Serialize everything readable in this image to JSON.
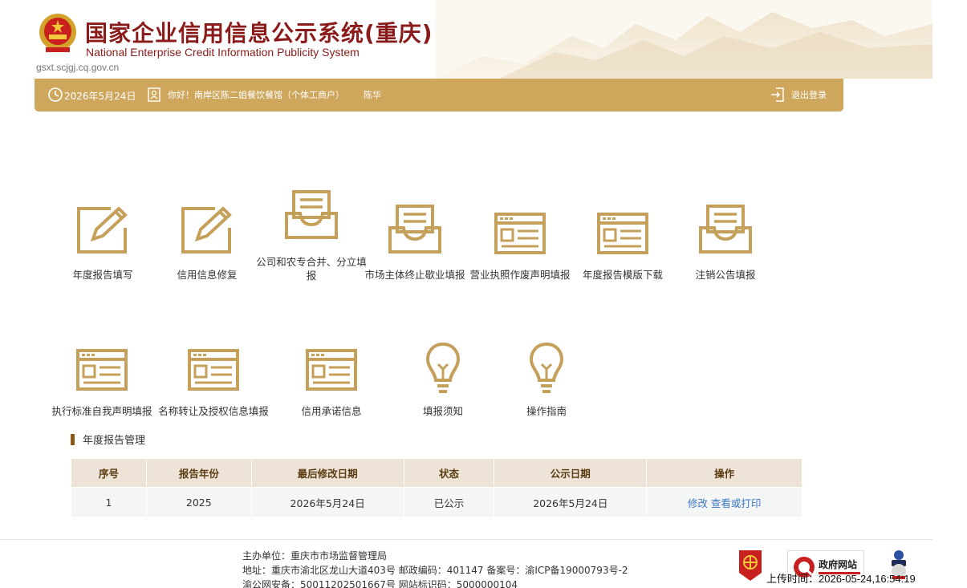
{
  "header": {
    "title_cn": "国家企业信用信息公示系统(重庆)",
    "title_en": "National Enterprise Credit Information Publicity System",
    "domain": "gsxt.scjgj.cq.gov.cn"
  },
  "topbar": {
    "date": "2026年5月24日",
    "greeting": "你好！南岸区陈二姐餐饮餐馆（个体工商户）",
    "user_name": "陈华",
    "logout_label": "退出登录"
  },
  "tiles": [
    {
      "label": "年度报告填写",
      "icon": "edit-icon"
    },
    {
      "label": "信用信息修复",
      "icon": "edit-icon"
    },
    {
      "label": "公司和农专合并、分立填报",
      "icon": "tray-icon"
    },
    {
      "label": "市场主体终止歇业填报",
      "icon": "tray-icon"
    },
    {
      "label": "营业执照作废声明填报",
      "icon": "form-window-icon"
    },
    {
      "label": "年度报告模版下载",
      "icon": "form-window-icon"
    },
    {
      "label": "注销公告填报",
      "icon": "tray-icon"
    },
    {
      "label": "执行标准自我声明填报",
      "icon": "form-window-icon"
    },
    {
      "label": "名称转让及授权信息填报",
      "icon": "form-window-icon"
    },
    {
      "label": "信用承诺信息",
      "icon": "form-window-icon"
    },
    {
      "label": "填报须知",
      "icon": "lightbulb-icon"
    },
    {
      "label": "操作指南",
      "icon": "lightbulb-icon"
    }
  ],
  "section": {
    "title": "年度报告管理"
  },
  "table": {
    "headers": [
      "序号",
      "报告年份",
      "最后修改日期",
      "状态",
      "公示日期",
      "操作"
    ],
    "rows": [
      {
        "no": "1",
        "year": "2025",
        "modified": "2026年5月24日",
        "status": "已公示",
        "published": "2026年5月24日",
        "action_edit": "修改",
        "action_view": "查看或打印"
      }
    ]
  },
  "footer": {
    "host": "主办单位：重庆市市场监督管理局",
    "address": "地址：重庆市渝北区龙山大道403号 邮政编码：401147 备案号：渝ICP备19000793号-2",
    "security": "渝公网安备：50011202501667号 网站标识码：5000000104",
    "badge_gov": "政府网站",
    "upload_time": "上传时间：2026-05-24,16:54:19"
  },
  "colors": {
    "gold": "#cea75d",
    "title_red": "#8b1a1a",
    "link_blue": "#3a78c3",
    "icon_gold": "#c4a05a"
  }
}
